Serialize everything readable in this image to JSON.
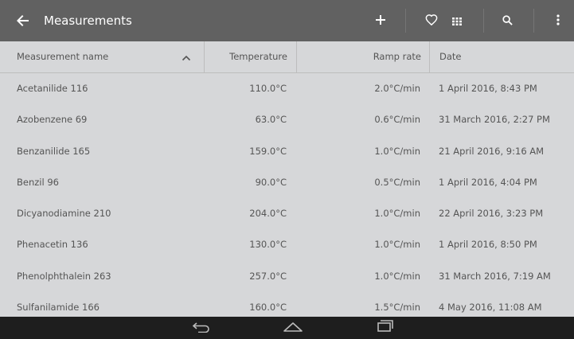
{
  "appbar": {
    "title": "Measurements",
    "icons": [
      "back-arrow-icon",
      "add-icon",
      "heart-icon",
      "grid-view-icon",
      "search-icon",
      "more-vert-icon"
    ]
  },
  "table": {
    "headers": {
      "name": "Measurement name",
      "temperature": "Temperature",
      "ramp": "Ramp rate",
      "date": "Date"
    },
    "sort": "ascending",
    "rows": [
      {
        "name": "Acetanilide 116",
        "temperature": "110.0°C",
        "ramp": "2.0°C/min",
        "date": "1 April 2016, 8:43 PM"
      },
      {
        "name": "Azobenzene 69",
        "temperature": "63.0°C",
        "ramp": "0.6°C/min",
        "date": "31 March 2016, 2:27 PM"
      },
      {
        "name": "Benzanilide 165",
        "temperature": "159.0°C",
        "ramp": "1.0°C/min",
        "date": "21 April 2016, 9:16 AM"
      },
      {
        "name": "Benzil 96",
        "temperature": "90.0°C",
        "ramp": "0.5°C/min",
        "date": "1 April 2016, 4:04 PM"
      },
      {
        "name": "Dicyanodiamine 210",
        "temperature": "204.0°C",
        "ramp": "1.0°C/min",
        "date": "22 April 2016, 3:23 PM"
      },
      {
        "name": "Phenacetin 136",
        "temperature": "130.0°C",
        "ramp": "1.0°C/min",
        "date": "1 April 2016, 8:50 PM"
      },
      {
        "name": "Phenolphthalein 263",
        "temperature": "257.0°C",
        "ramp": "1.0°C/min",
        "date": "31 March 2016, 7:19 AM"
      },
      {
        "name": "Sulfanilamide 166",
        "temperature": "160.0°C",
        "ramp": "1.5°C/min",
        "date": "4 May 2016, 11:08 AM"
      }
    ]
  },
  "navbar": {
    "icons": [
      "nav-back-icon",
      "nav-home-icon",
      "nav-recents-icon"
    ]
  },
  "colors": {
    "appbar": "#616161",
    "background": "#d6d7d9",
    "navbar": "#1e1e1e",
    "text": "#555555"
  }
}
